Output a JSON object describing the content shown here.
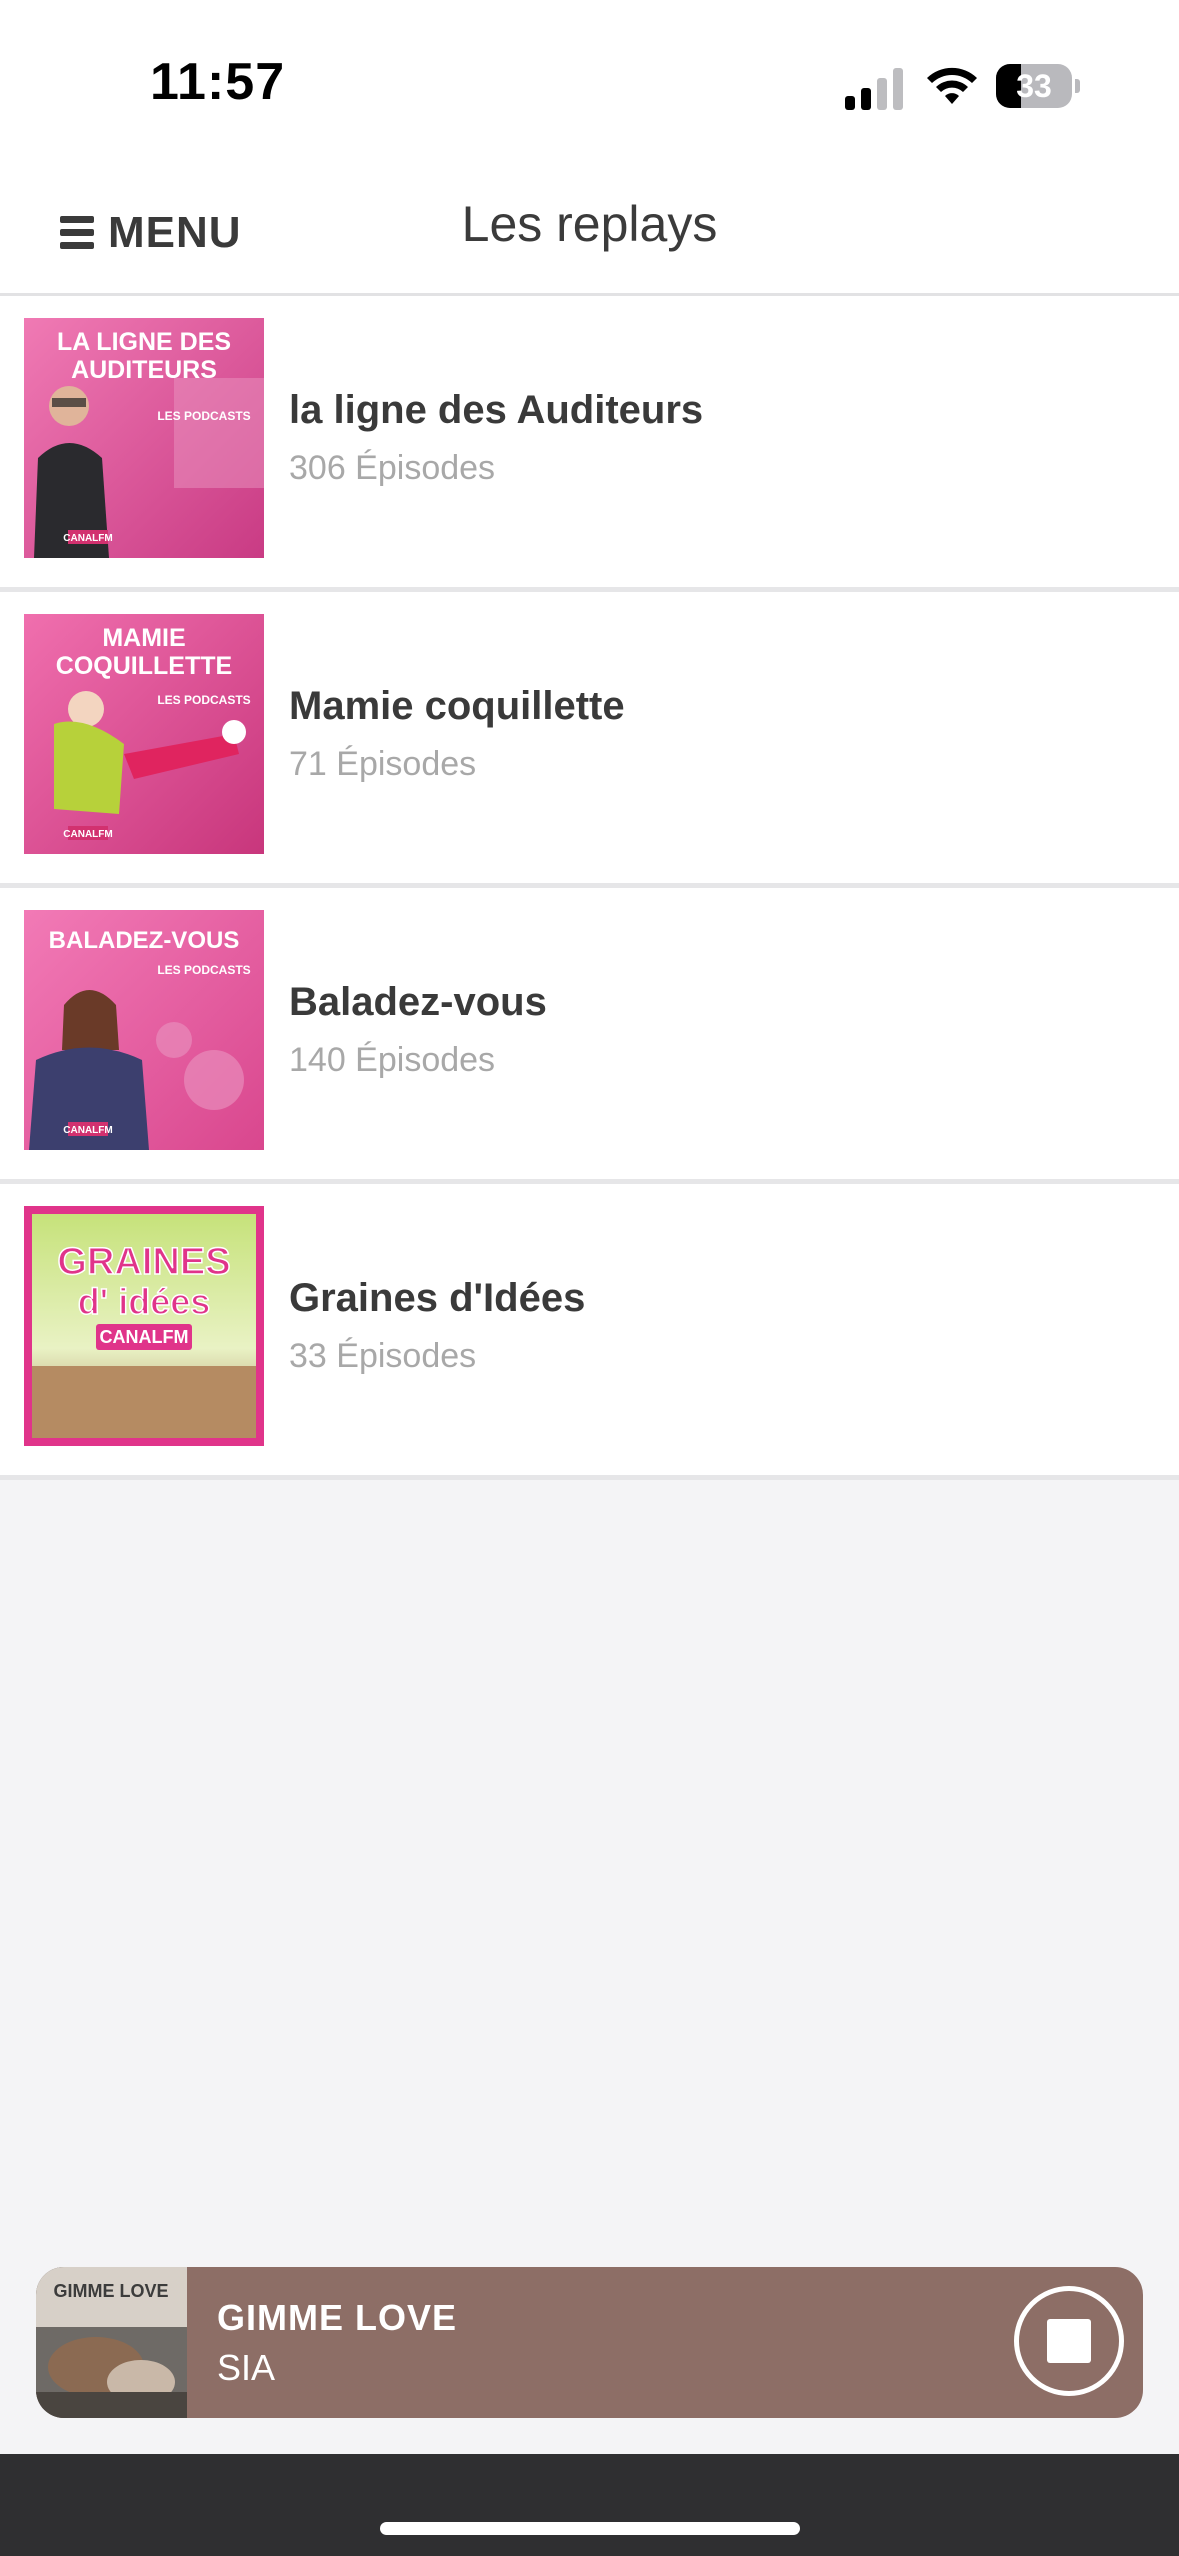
{
  "status_bar": {
    "time": "11:57",
    "battery_level": 33,
    "battery_text": "33",
    "signal_bars_active": 2,
    "signal_bars_total": 4
  },
  "nav": {
    "menu_label": "MENU",
    "menu_icon": "hamburger-icon",
    "title": "Les replays"
  },
  "podcasts": [
    {
      "title": "la ligne des Auditeurs",
      "episodes": "306 Épisodes",
      "cover_text": [
        "LA LIGNE DES",
        "AUDITEURS"
      ],
      "cover_subtitle": "LES PODCASTS",
      "cover_brand": "CANALFM"
    },
    {
      "title": "Mamie coquillette",
      "episodes": "71 Épisodes",
      "cover_text": [
        "MAMIE",
        "COQUILLETTE"
      ],
      "cover_subtitle": "LES PODCASTS",
      "cover_brand": "CANALFM"
    },
    {
      "title": "Baladez-vous",
      "episodes": "140 Épisodes",
      "cover_text": [
        "BALADEZ-VOUS"
      ],
      "cover_subtitle": "LES PODCASTS",
      "cover_brand": "CANALFM"
    },
    {
      "title": "Graines d'Idées",
      "episodes": "33 Épisodes",
      "cover_text": [
        "GRAINES",
        "d' idées"
      ],
      "cover_subtitle": "",
      "cover_brand": "CANALFM"
    }
  ],
  "player": {
    "track_title": "GIMME LOVE",
    "artist": "SIA",
    "art_text": "GIMME LOVE",
    "stop_icon": "stop-icon"
  },
  "colors": {
    "player_bg": "#8d6e66",
    "cover_pink": "#e8559b",
    "bottom_bar": "#2f2f31"
  }
}
